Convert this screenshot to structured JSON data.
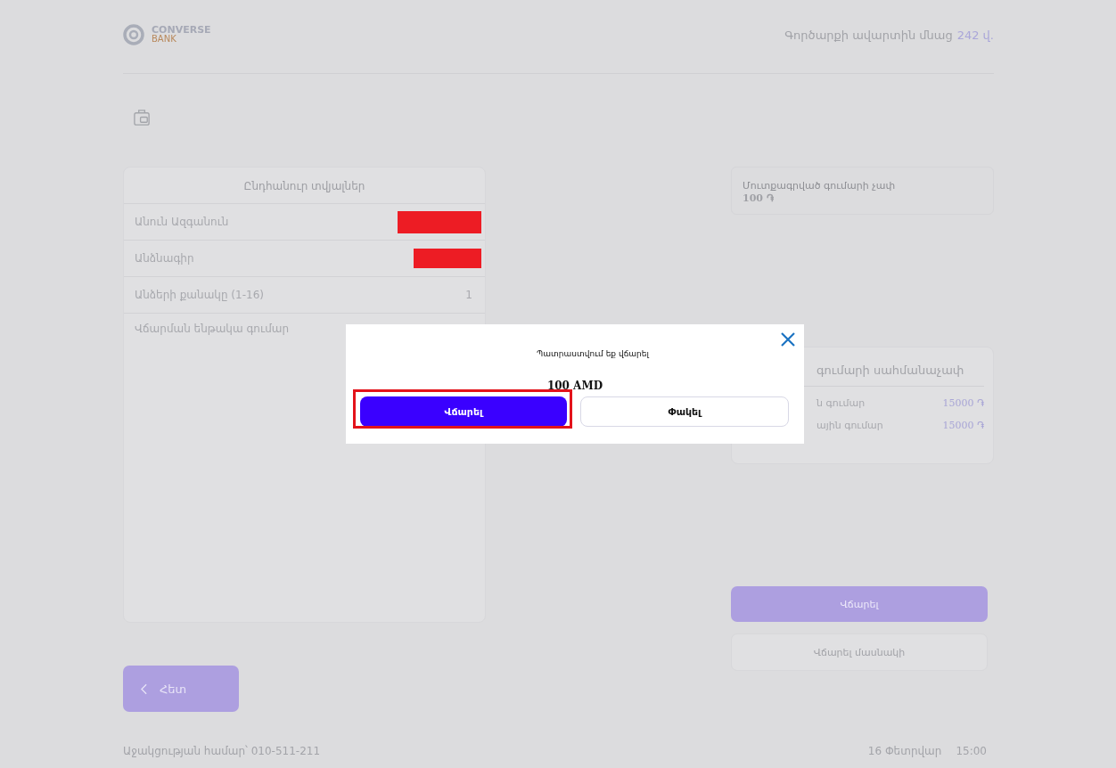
{
  "header": {
    "logo": {
      "line1": "CONVERSE",
      "line2": "BANK"
    },
    "timer": {
      "label": "Գործարքի ավարտին մնաց",
      "value": "242 վ."
    }
  },
  "general_card": {
    "title": "Ընդհանուր տվյալներ",
    "rows": [
      {
        "label": "Անուն Ազգանուն",
        "kind": "redacted"
      },
      {
        "label": "Անձնագիր",
        "kind": "redacted"
      },
      {
        "label": "Անձերի քանակը (1-16)",
        "kind": "text",
        "value": "1"
      },
      {
        "label": "Վճարման ենթակա գումար",
        "kind": "empty"
      }
    ]
  },
  "amount_field": {
    "label": "Մուտքագրված գումարի չափ",
    "value": "100 ֏"
  },
  "limits_card": {
    "title": "գումարի սահմանաչափ",
    "rows": [
      {
        "label": "ն գումար",
        "value": "15000 ֏"
      },
      {
        "label": "ային գումար",
        "value": "15000 ֏"
      }
    ]
  },
  "pay_button": "Վճարել",
  "partial_button": "Վճարել մասնակի",
  "back_button": "Հետ",
  "footer": {
    "support": "Աջակցության համար՝ 010-511-211",
    "date": "16 Փետրվար",
    "time": "15:00"
  },
  "modal": {
    "message": "Պատրաստվում եք վճարել",
    "amount": "100 AMD",
    "confirm": {
      "label": "Վճարել",
      "highlighted": true
    },
    "cancel": "Փակել"
  }
}
